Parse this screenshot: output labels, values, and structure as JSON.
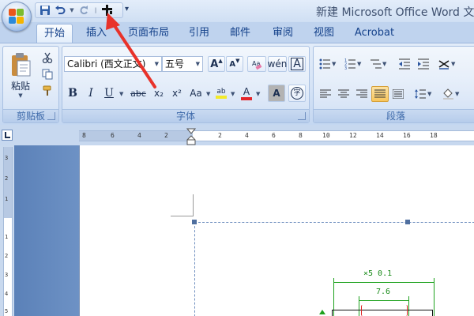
{
  "window": {
    "title": "新建 Microsoft Office Word 文档"
  },
  "quick_access": {
    "items": [
      "save-icon",
      "undo-icon",
      "redo-icon",
      "format-painter-icon"
    ],
    "more": "▾"
  },
  "tabs": [
    {
      "label": "开始",
      "active": true
    },
    {
      "label": "插入",
      "active": false
    },
    {
      "label": "页面布局",
      "active": false
    },
    {
      "label": "引用",
      "active": false
    },
    {
      "label": "邮件",
      "active": false
    },
    {
      "label": "审阅",
      "active": false
    },
    {
      "label": "视图",
      "active": false
    },
    {
      "label": "Acrobat",
      "active": false
    }
  ],
  "clipboard": {
    "group_label": "剪贴板",
    "paste_label": "粘贴"
  },
  "font": {
    "group_label": "字体",
    "font_name": "Calibri (西文正文)",
    "font_size": "五号",
    "bold": "B",
    "italic": "I",
    "underline": "U",
    "strike": "abc",
    "subscript": "x₂",
    "superscript": "x²",
    "change_case": "Aa",
    "grow": "A",
    "shrink": "A",
    "highlight": "ab",
    "font_color": "A",
    "char_shading": "A",
    "enclose": "字"
  },
  "paragraph": {
    "group_label": "段落"
  },
  "ruler": {
    "h_ticks": [
      "8",
      "6",
      "4",
      "2",
      "2",
      "4",
      "6",
      "8",
      "10",
      "12",
      "14",
      "16",
      "18"
    ],
    "v_ticks": [
      "3",
      "2",
      "1",
      "1",
      "2",
      "3",
      "4",
      "5"
    ]
  },
  "drawing": {
    "dim_top": "×5  0.1",
    "dim_inner": "7.6"
  },
  "colors": {
    "annotation": "#e8322a",
    "tab_text": "#15428b",
    "group_label": "#3e6aaa",
    "dimension": "#1c8c1c"
  }
}
